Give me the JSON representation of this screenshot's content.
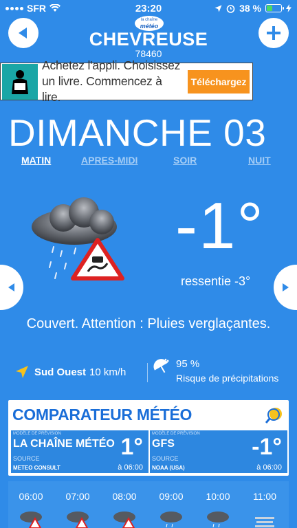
{
  "status": {
    "carrier": "SFR",
    "time": "23:20",
    "battery": "38 %",
    "battery_level": 0.38,
    "battery_color": "#4cd964"
  },
  "header": {
    "back_icon": "arrow-left-icon",
    "add_icon": "plus-icon",
    "logo_top": "la chaîne",
    "logo_brand": "météo",
    "city": "CHEVREUSE",
    "postal_code": "78460"
  },
  "ad": {
    "line1": "Achetez l'appli. Choisissez",
    "line2": "un livre. Commencez à lire.",
    "cta": "Téléchargez"
  },
  "forecast": {
    "day": "DIMANCHE 03",
    "tabs": [
      {
        "label": "MATIN",
        "active": true
      },
      {
        "label": "APRES-MIDI",
        "active": false
      },
      {
        "label": "SOIR",
        "active": false
      },
      {
        "label": "NUIT",
        "active": false
      }
    ],
    "temperature": "-1°",
    "feels_like": "ressentie -3°",
    "description": "Couvert. Attention : Pluies verglaçantes.",
    "wind_direction": "Sud Ouest",
    "wind_speed": "10 km/h",
    "rain_percent": "95 %",
    "rain_label": "Risque de précipitations"
  },
  "comparateur": {
    "title": "COMPARATEUR MÉTÉO",
    "models": [
      {
        "caption": "MODÈLE DE PRÉVISION",
        "name": "LA CHAÎNE MÉTÉO",
        "temp": "1°",
        "source_label": "SOURCE",
        "source": "METEO CONSULT",
        "time": "à 06:00"
      },
      {
        "caption": "MODÈLE DE PRÉVISION",
        "name": "GFS",
        "temp": "-1°",
        "source_label": "SOURCE",
        "source": "NOAA (USA)",
        "time": "à 06:00"
      }
    ]
  },
  "hourly": [
    "06:00",
    "07:00",
    "08:00",
    "09:00",
    "10:00",
    "11:00"
  ],
  "colors": {
    "background": "#2f8be8",
    "accent_orange": "#f7931e",
    "comparateur_title": "#1a6ed8"
  }
}
